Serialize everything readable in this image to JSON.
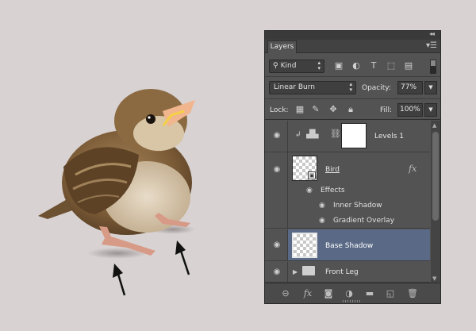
{
  "panel": {
    "tab_label": "Layers",
    "collapse_icon": "double-chevron-left-icon",
    "menu_icon": "panel-menu-icon"
  },
  "filter": {
    "kind_label": "Kind",
    "icons": [
      "image-filter-icon",
      "adjustment-filter-icon",
      "type-filter-icon",
      "shape-filter-icon",
      "smart-object-filter-icon"
    ]
  },
  "blend": {
    "mode": "Linear Burn",
    "opacity_label": "Opacity:",
    "opacity_value": "77%"
  },
  "lock": {
    "label": "Lock:",
    "fill_label": "Fill:",
    "fill_value": "100%"
  },
  "layers": [
    {
      "name": "Levels 1",
      "type": "adjustment"
    },
    {
      "name": "Bird",
      "type": "pixel",
      "effects_label": "Effects",
      "effects": [
        "Inner Shadow",
        "Gradient Overlay"
      ],
      "fx_icon": "fx-icon"
    },
    {
      "name": "Base Shadow",
      "type": "pixel",
      "selected": true
    },
    {
      "name": "Front Leg",
      "type": "group"
    }
  ],
  "footer_icons": [
    "link-layers-icon",
    "fx-style-icon",
    "layer-mask-icon",
    "adjustment-layer-icon",
    "new-group-icon",
    "new-layer-icon",
    "trash-icon"
  ],
  "colors": {
    "selected_layer": "#5a6a86",
    "panel_bg": "#535353",
    "canvas_bg": "#d8d2d2"
  }
}
